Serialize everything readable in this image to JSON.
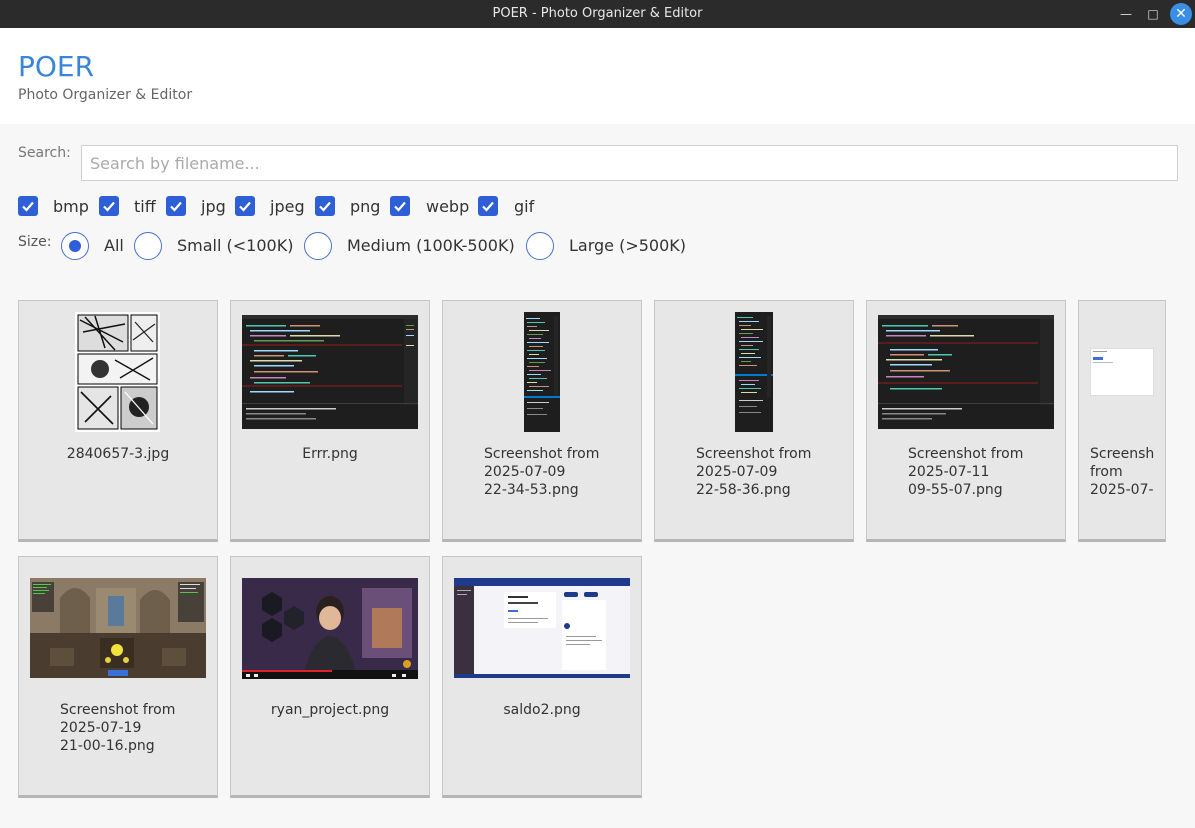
{
  "window": {
    "title": "POER - Photo Organizer & Editor",
    "controls": {
      "minimize": "—",
      "maximize": "□",
      "close": "✕"
    }
  },
  "header": {
    "app_name": "POER",
    "subtitle": "Photo Organizer & Editor"
  },
  "search": {
    "label": "Search:",
    "placeholder": "Search by filename...",
    "value": ""
  },
  "extensions": [
    {
      "label": "bmp",
      "checked": true
    },
    {
      "label": "tiff",
      "checked": true
    },
    {
      "label": "jpg",
      "checked": true
    },
    {
      "label": "jpeg",
      "checked": true
    },
    {
      "label": "png",
      "checked": true
    },
    {
      "label": "webp",
      "checked": true
    },
    {
      "label": "gif",
      "checked": true
    }
  ],
  "size_filter": {
    "label": "Size:",
    "options": [
      {
        "label": "All",
        "selected": true
      },
      {
        "label": "Small (<100K)",
        "selected": false
      },
      {
        "label": "Medium (100K-500K)",
        "selected": false
      },
      {
        "label": "Large (>500K)",
        "selected": false
      }
    ]
  },
  "gallery": [
    {
      "name": "2840657-3.jpg",
      "thumb": "manga-page"
    },
    {
      "name": "Errr.png",
      "thumb": "code-editor"
    },
    {
      "name": "Screenshot from\n2025-07-09\n22-34-53.png",
      "thumb": "code-editor-narrow"
    },
    {
      "name": "Screenshot from\n2025-07-09\n22-58-36.png",
      "thumb": "code-editor-narrow"
    },
    {
      "name": "Screenshot from\n2025-07-11\n09-55-07.png",
      "thumb": "code-editor"
    },
    {
      "name": "Screensh\nfrom\n2025-07-",
      "thumb": "web-page-small"
    },
    {
      "name": "Screenshot from\n2025-07-19\n21-00-16.png",
      "thumb": "game-scene"
    },
    {
      "name": "ryan_project.png",
      "thumb": "video-stream"
    },
    {
      "name": "saldo2.png",
      "thumb": "web-app"
    }
  ],
  "colors": {
    "accent": "#3a85d8",
    "checkbox": "#2f5fd6",
    "titlebar": "#2b2b2b"
  }
}
